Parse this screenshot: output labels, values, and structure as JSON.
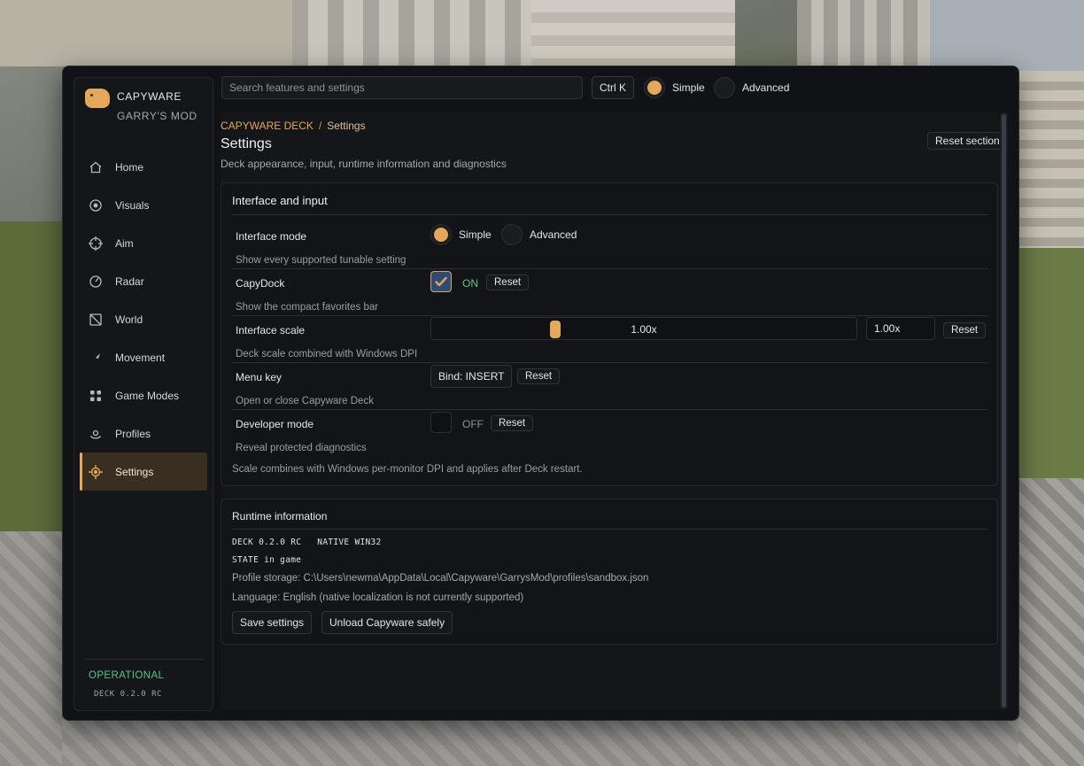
{
  "sidebar": {
    "brand": {
      "title": "CAPYWARE",
      "subtitle": "GARRY'S MOD"
    },
    "items": [
      {
        "label": "Home",
        "icon": "home-icon"
      },
      {
        "label": "Visuals",
        "icon": "eye-icon"
      },
      {
        "label": "Aim",
        "icon": "crosshair-icon"
      },
      {
        "label": "Radar",
        "icon": "radar-icon"
      },
      {
        "label": "World",
        "icon": "world-icon"
      },
      {
        "label": "Movement",
        "icon": "movement-icon"
      },
      {
        "label": "Game Modes",
        "icon": "grid-icon"
      },
      {
        "label": "Profiles",
        "icon": "profile-icon"
      },
      {
        "label": "Settings",
        "icon": "settings-icon",
        "active": true
      }
    ],
    "status": "OPERATIONAL",
    "version": "DECK 0.2.0 RC"
  },
  "topbar": {
    "search_placeholder": "Search features and settings",
    "shortcut": "Ctrl K",
    "mode_simple": "Simple",
    "mode_advanced": "Advanced",
    "selected_mode": "Simple"
  },
  "page": {
    "breadcrumb_root": "CAPYWARE DECK",
    "breadcrumb_sep": "/",
    "breadcrumb_current": "Settings",
    "title": "Settings",
    "description": "Deck appearance, input, runtime information and diagnostics",
    "reset_section": "Reset section"
  },
  "interface_card": {
    "title": "Interface and input",
    "interface_mode": {
      "label": "Interface mode",
      "option_simple": "Simple",
      "option_advanced": "Advanced",
      "selected": "Simple",
      "help": "Show every supported tunable setting"
    },
    "capydock": {
      "label": "CapyDock",
      "state": "ON",
      "reset": "Reset",
      "help": "Show the compact favorites bar"
    },
    "interface_scale": {
      "label": "Interface scale",
      "value_text": "1.00x",
      "input_value": "1.00x",
      "reset": "Reset",
      "help": "Deck scale combined with Windows DPI"
    },
    "menu_key": {
      "label": "Menu key",
      "bind": "Bind: INSERT",
      "reset": "Reset",
      "help": "Open or close Capyware Deck"
    },
    "developer_mode": {
      "label": "Developer mode",
      "state": "OFF",
      "reset": "Reset",
      "help": "Reveal protected diagnostics"
    },
    "footnote": "Scale combines with Windows per-monitor DPI and applies after Deck restart."
  },
  "runtime_card": {
    "title": "Runtime information",
    "line1": "DECK 0.2.0 RC   NATIVE WIN32",
    "line2": "STATE in game",
    "profile_storage": "Profile storage: C:\\Users\\newma\\AppData\\Local\\Capyware\\GarrysMod\\profiles\\sandbox.json",
    "language": "Language: English (native localization is not currently supported)",
    "save_button": "Save settings",
    "unload_button": "Unload Capyware safely"
  },
  "colors": {
    "accent": "#e3a85a",
    "status_ok": "#58c58f",
    "window_bg": "#101216"
  }
}
